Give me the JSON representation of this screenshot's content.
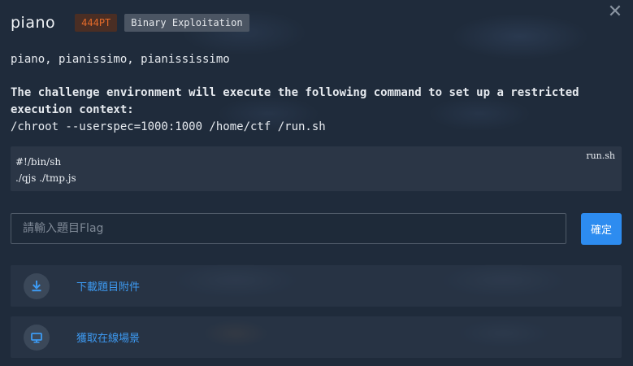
{
  "challenge": {
    "name": "piano",
    "points": "444PT",
    "category": "Binary Exploitation",
    "subtitle": "piano, pianissimo, pianississimo",
    "setup_line1": "The challenge environment will execute the following command to set up a restricted",
    "setup_line2": "execution context:",
    "command": "/chroot --userspec=1000:1000 /home/ctf /run.sh"
  },
  "code_block": {
    "filename": "run.sh",
    "lines": [
      "#!/bin/sh",
      "./qjs ./tmp.js"
    ]
  },
  "flag_form": {
    "placeholder": "請輸入題目Flag",
    "value": "",
    "submit_label": "確定"
  },
  "actions": {
    "download_label": "下載題目附件",
    "scene_label": "獲取在線場景"
  },
  "icons": {
    "close": "close-icon",
    "download": "download-icon",
    "monitor": "monitor-icon"
  },
  "colors": {
    "accent": "#2d8cf0",
    "link": "#3d9af2",
    "points_text": "#e56b2a",
    "points_bg": "#4a2e24",
    "category_bg": "#4b5563"
  }
}
